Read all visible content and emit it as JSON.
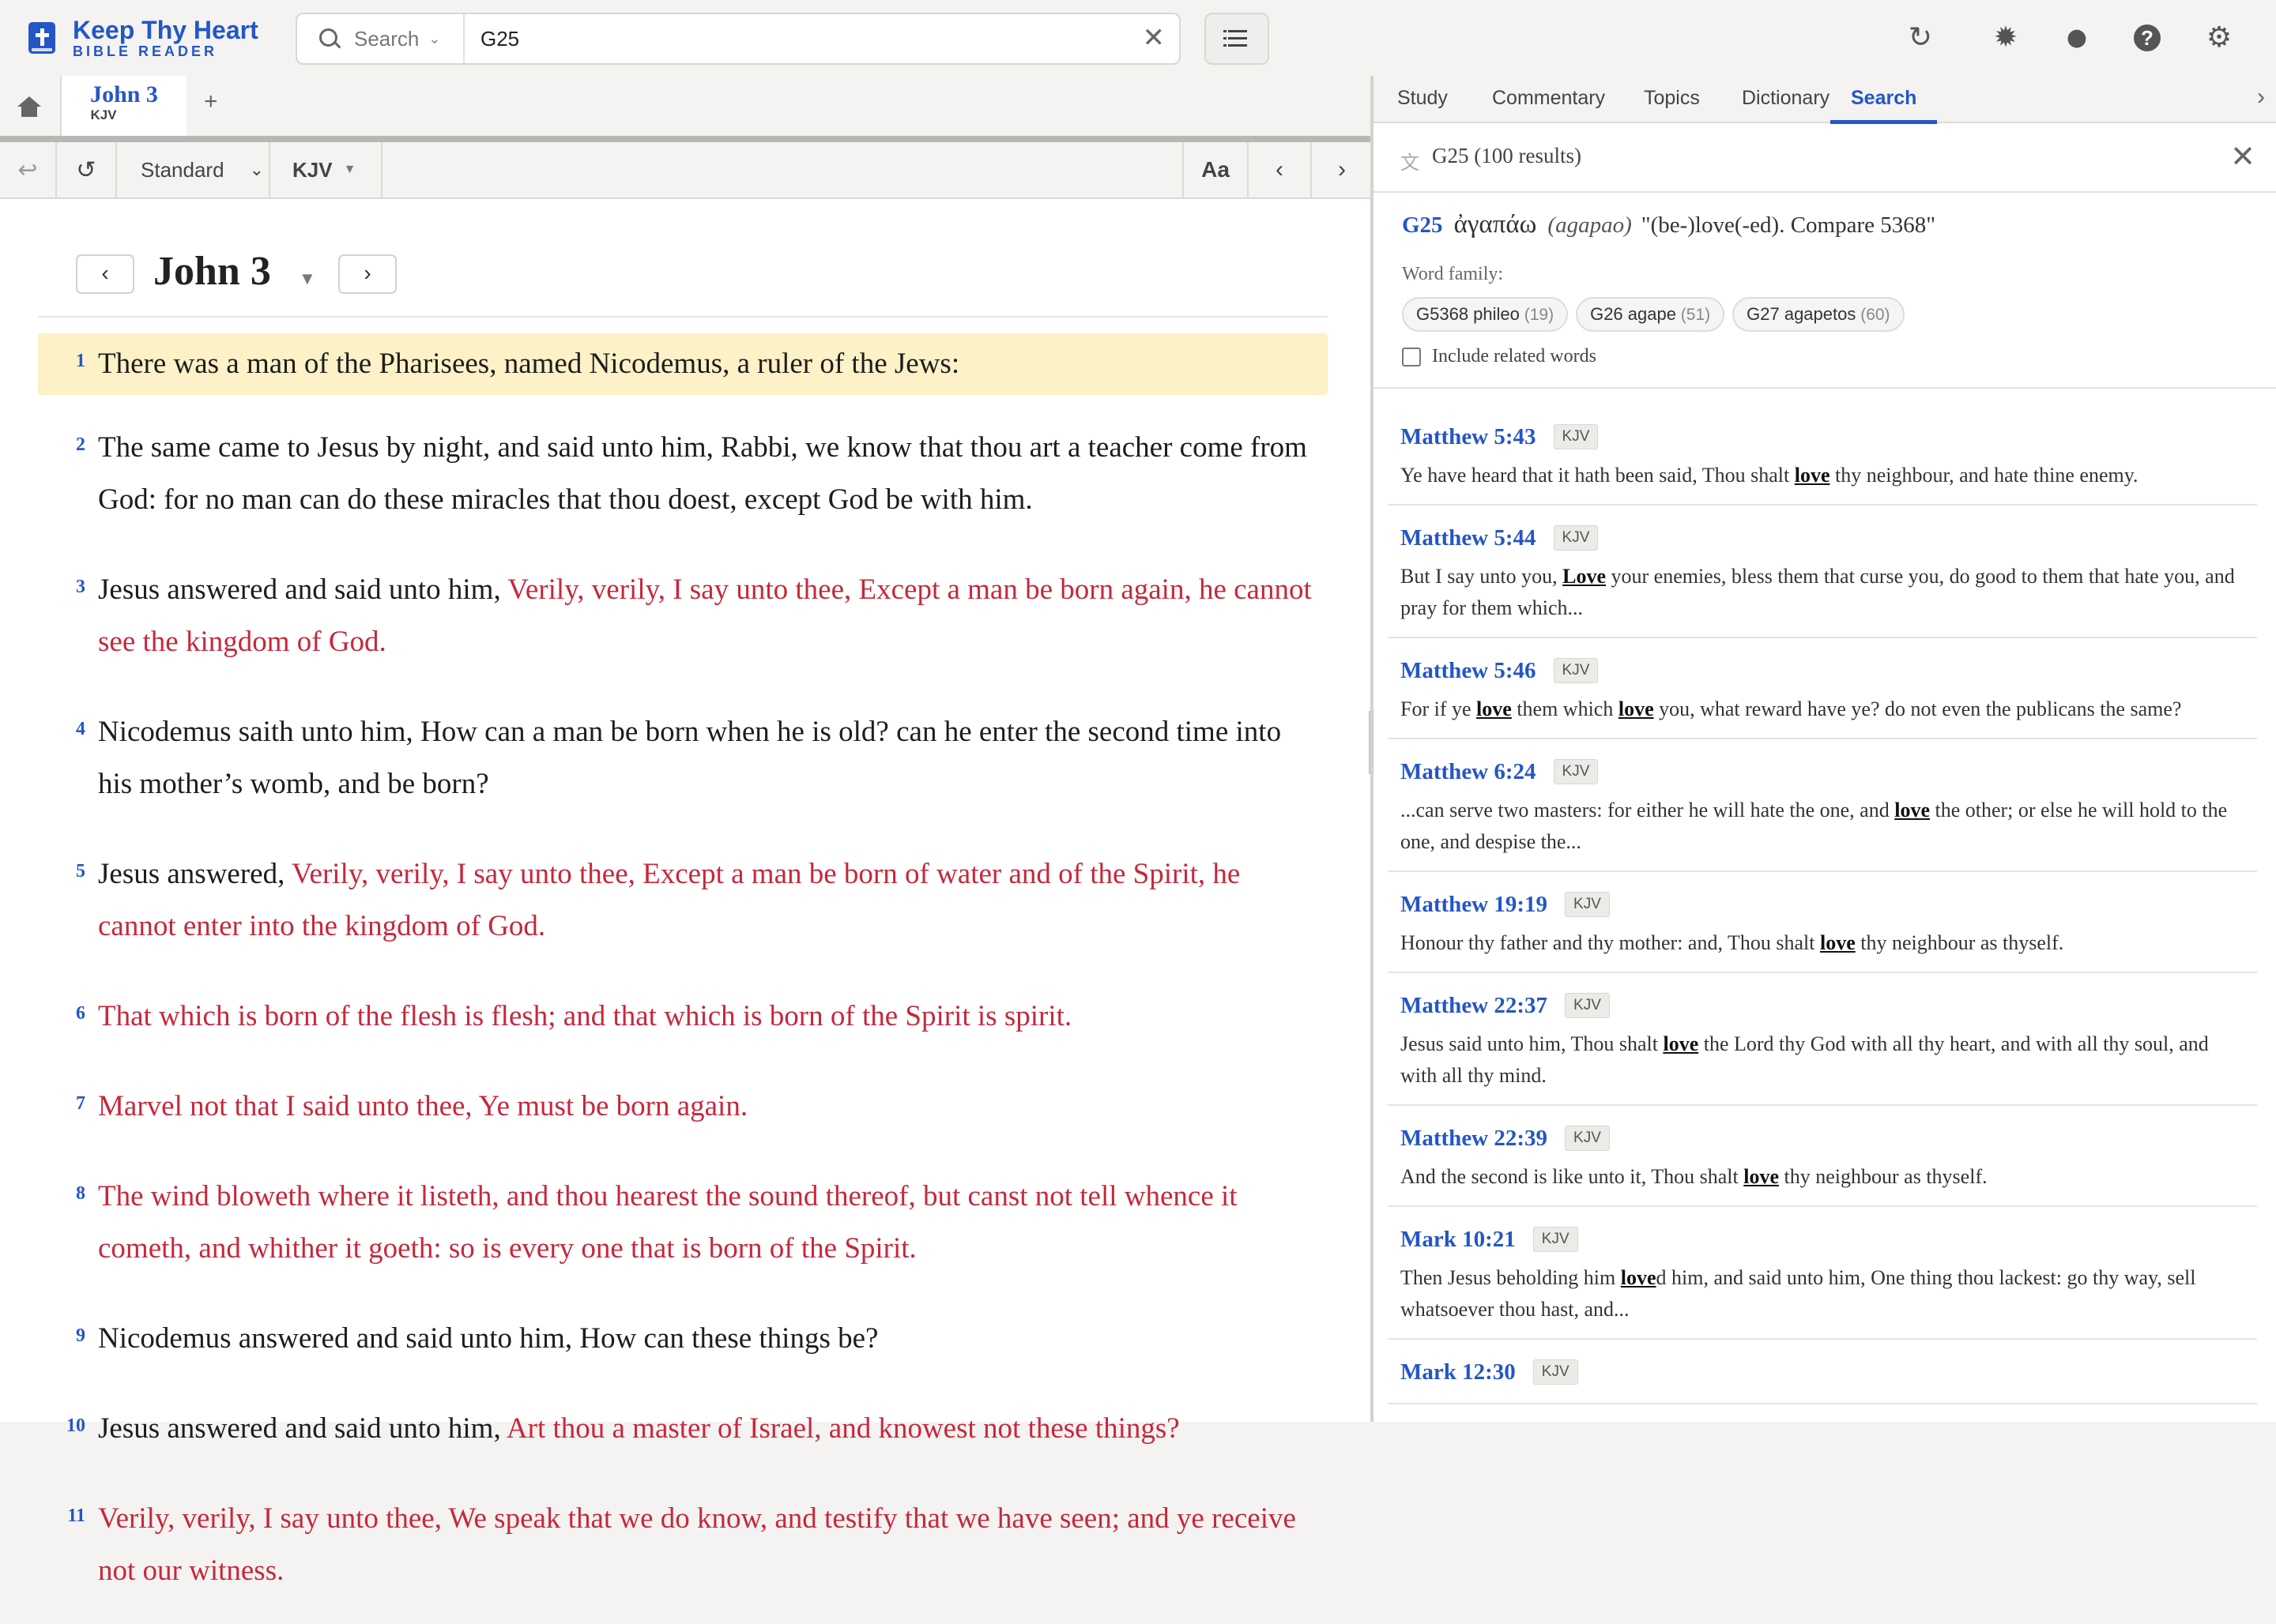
{
  "app": {
    "name": "Keep Thy Heart",
    "tagline": "BIBLE READER"
  },
  "search": {
    "mode_label": "Search",
    "value": "G25",
    "clear": "✕"
  },
  "tabs": [
    {
      "title": "John 3",
      "version": "KJV"
    }
  ],
  "add_tab": "+",
  "toolbar": {
    "format": "Standard",
    "version": "KJV",
    "font_btn": "Aa",
    "prev": "‹",
    "next": "›"
  },
  "chapter": {
    "title": "John 3",
    "prev": "‹",
    "next": "›",
    "verses": [
      {
        "n": "1",
        "parts": [
          {
            "t": "There was a man of the Pharisees, named Nicodemus, a ruler of the Jews:"
          }
        ]
      },
      {
        "n": "2",
        "parts": [
          {
            "t": "The same came to Jesus by night, and said unto him, Rabbi, we know that thou art a teacher come from God: for no man can do these miracles that thou doest, except God be with him."
          }
        ]
      },
      {
        "n": "3",
        "parts": [
          {
            "t": "Jesus answered and said unto him, "
          },
          {
            "t": "Verily, verily, I say unto thee, Except a man be born again, he cannot see the kingdom of God.",
            "red": true
          }
        ]
      },
      {
        "n": "4",
        "parts": [
          {
            "t": "Nicodemus saith unto him, How can a man be born when he is old? can he enter the second time into his mother’s womb, and be born?"
          }
        ]
      },
      {
        "n": "5",
        "parts": [
          {
            "t": "Jesus answered, "
          },
          {
            "t": "Verily, verily, I say unto thee, Except a man be born of water and of the Spirit, he cannot enter into the kingdom of God.",
            "red": true
          }
        ]
      },
      {
        "n": "6",
        "parts": [
          {
            "t": "That which is born of the flesh is flesh; and that which is born of the Spirit is spirit.",
            "red": true
          }
        ]
      },
      {
        "n": "7",
        "parts": [
          {
            "t": "Marvel not that I said unto thee, Ye must be born again.",
            "red": true
          }
        ]
      },
      {
        "n": "8",
        "parts": [
          {
            "t": "The wind bloweth where it listeth, and thou hearest the sound thereof, but canst not tell whence it cometh, and whither it goeth: so is every one that is born of the Spirit.",
            "red": true
          }
        ]
      },
      {
        "n": "9",
        "parts": [
          {
            "t": "Nicodemus answered and said unto him, How can these things be?"
          }
        ]
      },
      {
        "n": "10",
        "parts": [
          {
            "t": "Jesus answered and said unto him, "
          },
          {
            "t": "Art thou a master of Israel, and knowest not these things?",
            "red": true
          }
        ]
      },
      {
        "n": "11",
        "parts": [
          {
            "t": "Verily, verily, I say unto thee, We speak that we do know, and testify that we have seen; and ye receive not our witness.",
            "red": true
          }
        ]
      }
    ]
  },
  "panel": {
    "tabs": [
      "Study",
      "Commentary",
      "Topics",
      "Dictionary",
      "Search"
    ],
    "active_tab": "Search",
    "query_summary": "G25 (100 results)",
    "lexicon": {
      "number": "G25",
      "greek": "ἀγαπάω",
      "translit": "(agapao)",
      "definition": "\"(be-)love(-ed). Compare 5368\"",
      "family_label": "Word family:",
      "family": [
        {
          "label": "G5368 phileo",
          "count": "(19)"
        },
        {
          "label": "G26 agape",
          "count": "(51)"
        },
        {
          "label": "G27 agapetos",
          "count": "(60)"
        }
      ],
      "include_related": "Include related words"
    },
    "results": [
      {
        "ref": "Matthew 5:43",
        "ver": "KJV",
        "parts": [
          {
            "t": "Ye have heard that it hath been said, Thou shalt "
          },
          {
            "t": "love",
            "b": true
          },
          {
            "t": " thy neighbour, and hate thine enemy."
          }
        ]
      },
      {
        "ref": "Matthew 5:44",
        "ver": "KJV",
        "parts": [
          {
            "t": "But I say unto you, "
          },
          {
            "t": "Love",
            "b": true
          },
          {
            "t": " your enemies, bless them that curse you, do good to them that hate you, and pray for them which..."
          }
        ]
      },
      {
        "ref": "Matthew 5:46",
        "ver": "KJV",
        "parts": [
          {
            "t": "For if ye "
          },
          {
            "t": "love",
            "b": true
          },
          {
            "t": " them which "
          },
          {
            "t": "love",
            "b": true
          },
          {
            "t": " you, what reward have ye? do not even the publicans the same?"
          }
        ]
      },
      {
        "ref": "Matthew 6:24",
        "ver": "KJV",
        "parts": [
          {
            "t": "...can serve two masters: for either he will hate the one, and "
          },
          {
            "t": "love",
            "b": true
          },
          {
            "t": " the other; or else he will hold to the one, and despise the..."
          }
        ]
      },
      {
        "ref": "Matthew 19:19",
        "ver": "KJV",
        "parts": [
          {
            "t": "Honour thy father and thy mother: and, Thou shalt "
          },
          {
            "t": "love",
            "b": true
          },
          {
            "t": " thy neighbour as thyself."
          }
        ]
      },
      {
        "ref": "Matthew 22:37",
        "ver": "KJV",
        "parts": [
          {
            "t": "Jesus said unto him, Thou shalt "
          },
          {
            "t": "love",
            "b": true
          },
          {
            "t": " the Lord thy God with all thy heart, and with all thy soul, and with all thy mind."
          }
        ]
      },
      {
        "ref": "Matthew 22:39",
        "ver": "KJV",
        "parts": [
          {
            "t": "And the second is like unto it, Thou shalt "
          },
          {
            "t": "love",
            "b": true
          },
          {
            "t": " thy neighbour as thyself."
          }
        ]
      },
      {
        "ref": "Mark 10:21",
        "ver": "KJV",
        "parts": [
          {
            "t": "Then Jesus beholding him "
          },
          {
            "t": "love",
            "b": true
          },
          {
            "t": "d him, and said unto him, One thing thou lackest: go thy way, sell whatsoever thou hast, and..."
          }
        ]
      },
      {
        "ref": "Mark 12:30",
        "ver": "KJV",
        "parts": []
      }
    ]
  },
  "colors": {
    "brand": "#2456c6",
    "words_of_christ": "#c6283c",
    "highlight": "#fdf1c7"
  },
  "icons": [
    "bible-logo-icon",
    "search-icon",
    "chevron-down-icon",
    "close-icon",
    "list-icon",
    "refresh-icon",
    "theme-icon",
    "chat-icon",
    "help-icon",
    "gear-icon",
    "home-icon",
    "undo-icon",
    "history-icon",
    "chevron-left-icon",
    "chevron-right-icon",
    "translate-icon"
  ]
}
